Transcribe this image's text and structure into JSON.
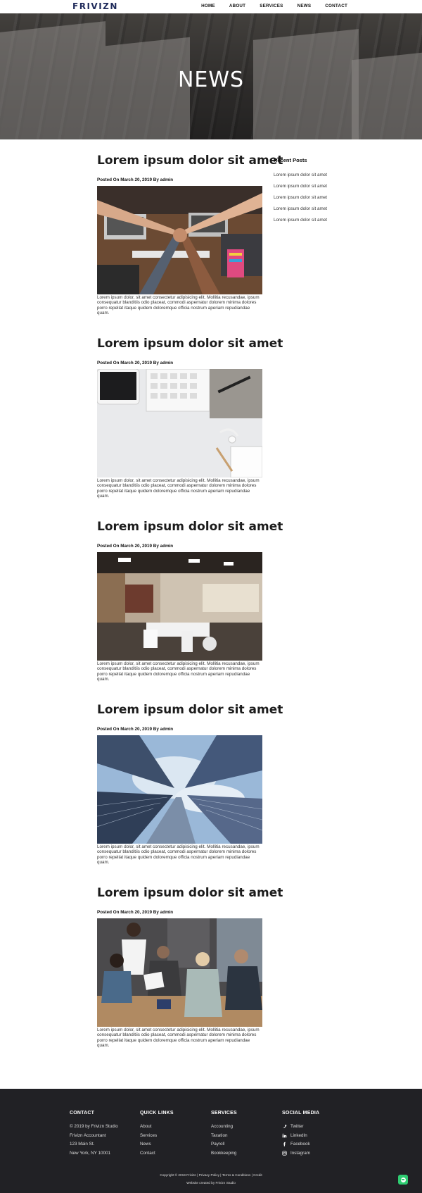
{
  "brand": {
    "logo": "FRIVIZN"
  },
  "nav": {
    "items": [
      {
        "label": "HOME"
      },
      {
        "label": "ABOUT"
      },
      {
        "label": "SERVICES"
      },
      {
        "label": "NEWS"
      },
      {
        "label": "CONTACT"
      }
    ]
  },
  "hero": {
    "title": "NEWS"
  },
  "posts": [
    {
      "title": "Lorem ipsum dolor sit amet",
      "meta": "Posted On March 20, 2019 By admin",
      "excerpt": "Lorem ipsum dolor, sit amet consectetur adipisicing elit. Mollitia recusandae, ipsum consequatur blanditiis odio placeat, commodi aspernatur dolorem minima dolores porro repellat itaque quidem doloremque officia nostrum aperiam repudiandae quam."
    },
    {
      "title": "Lorem ipsum dolor sit amet",
      "meta": "Posted On March 20, 2019 By admin",
      "excerpt": "Lorem ipsum dolor, sit amet consectetur adipisicing elit. Mollitia recusandae, ipsum consequatur blanditiis odio placeat, commodi aspernatur dolorem minima dolores porro repellat itaque quidem doloremque officia nostrum aperiam repudiandae quam."
    },
    {
      "title": "Lorem ipsum dolor sit amet",
      "meta": "Posted On March 20, 2019 By admin",
      "excerpt": "Lorem ipsum dolor, sit amet consectetur adipisicing elit. Mollitia recusandae, ipsum consequatur blanditiis odio placeat, commodi aspernatur dolorem minima dolores porro repellat itaque quidem doloremque officia nostrum aperiam repudiandae quam."
    },
    {
      "title": "Lorem ipsum dolor sit amet",
      "meta": "Posted On March 20, 2019 By admin",
      "excerpt": "Lorem ipsum dolor, sit amet consectetur adipisicing elit. Mollitia recusandae, ipsum consequatur blanditiis odio placeat, commodi aspernatur dolorem minima dolores porro repellat itaque quidem doloremque officia nostrum aperiam repudiandae quam."
    },
    {
      "title": "Lorem ipsum dolor sit amet",
      "meta": "Posted On March 20, 2019 By admin",
      "excerpt": "Lorem ipsum dolor, sit amet consectetur adipisicing elit. Mollitia recusandae, ipsum consequatur blanditiis odio placeat, commodi aspernatur dolorem minima dolores porro repellat itaque quidem doloremque officia nostrum aperiam repudiandae quam."
    }
  ],
  "sidebar": {
    "title": "Recent Posts",
    "items": [
      {
        "label": "Lorem ipsum dolor sit amet"
      },
      {
        "label": "Lorem ipsum dolor sit amet"
      },
      {
        "label": "Lorem ipsum dolor sit amet"
      },
      {
        "label": "Lorem ipsum dolor sit amet"
      },
      {
        "label": "Lorem ipsum dolor sit amet"
      }
    ]
  },
  "footer": {
    "contact": {
      "title": "CONTACT",
      "lines": [
        "© 2019 by Frivizn Studio",
        "Frivizn Accountant",
        "123 Main St.",
        "New York, NY 10001"
      ]
    },
    "quick_links": {
      "title": "QUICK LINKS",
      "items": [
        "About",
        "Services",
        "News",
        "Contact"
      ]
    },
    "services": {
      "title": "SERVICES",
      "items": [
        "Accounting",
        "Taxation",
        "Payroll",
        "Bookkeeping"
      ]
    },
    "social": {
      "title": "SOCIAL MEDIA",
      "items": [
        {
          "label": "Twitter",
          "icon": "twitter-icon"
        },
        {
          "label": "LinkedIn",
          "icon": "linkedin-icon"
        },
        {
          "label": "Facebook",
          "icon": "facebook-icon"
        },
        {
          "label": "Instagram",
          "icon": "instagram-icon"
        }
      ]
    },
    "copyright": "Copyright © 2019 Frivizn | Privacy Policy | Terms & Conditions | Credit",
    "credit": "Website created by Frivizn Studio"
  },
  "colors": {
    "logo": "#1f2a5a",
    "footer_bg": "#212125",
    "chat_button": "#2ecc71"
  }
}
